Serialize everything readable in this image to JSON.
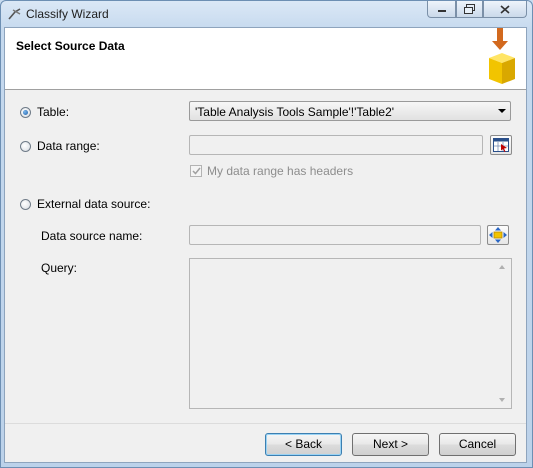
{
  "window": {
    "title": "Classify Wizard"
  },
  "header": {
    "title": "Select Source Data"
  },
  "source": {
    "table": {
      "label": "Table:",
      "selected": true,
      "value": "'Table Analysis Tools Sample'!'Table2'"
    },
    "data_range": {
      "label": "Data range:",
      "selected": false,
      "value": "",
      "headers_checkbox_label": "My data range has headers",
      "headers_checked": true
    },
    "external": {
      "label": "External data source:",
      "selected": false,
      "name_label": "Data source name:",
      "name_value": "",
      "query_label": "Query:",
      "query_value": ""
    }
  },
  "buttons": {
    "back": "< Back",
    "next": "Next >",
    "cancel": "Cancel"
  },
  "icons": {
    "app": "wizard-pick-icon",
    "header": "data-import-graphic",
    "range_picker": "range-select-icon",
    "data_source": "data-source-icon"
  },
  "colors": {
    "header_arrow": "#d2691e",
    "header_cube": "#f2c400",
    "radio_fill": "#1d5fa8"
  }
}
